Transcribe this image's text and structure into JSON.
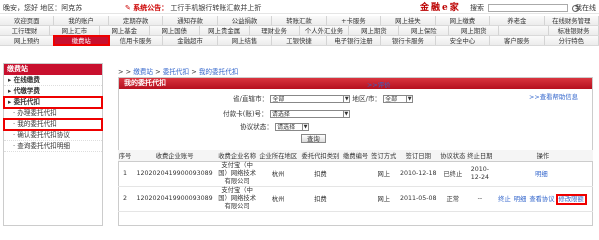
{
  "top": {
    "user_info": "晚安，您好 地区：阿克苏",
    "notice_label": "系统公告：",
    "notice_text": "工行手机银行转账汇款并上折",
    "logo": "金融e家",
    "search_label": "搜索",
    "logout": "我在线"
  },
  "nav": {
    "row1": [
      "欢迎页面",
      "我的账户",
      "定期存款",
      "通知存款",
      "公益捐款",
      "转账汇款",
      "+卡服务",
      "网上挂失",
      "网上缴费",
      "养老金",
      "在线财务管理"
    ],
    "row2": [
      "工行理财",
      "网上汇市",
      "网上基金",
      "网上国债",
      "网上贵金属",
      "理财业务",
      "个人外汇业务",
      "网上期货",
      "网上保险",
      "网上期货",
      "",
      "标准银财务"
    ],
    "row3": [
      "网上预约",
      "缴费站",
      "信用卡服务",
      "金融超市",
      "网上结售",
      "工银快捷",
      "电子银行注册",
      "银行卡服务",
      "安全中心",
      "客户服务",
      "分行特色"
    ]
  },
  "sidebar": {
    "head": "缴费站",
    "items": [
      {
        "label": "在线缴费",
        "group": true,
        "hl": false
      },
      {
        "label": "代缴学费",
        "group": true,
        "hl": false
      },
      {
        "label": "委托代扣",
        "group": true,
        "hl": true
      },
      {
        "label": "办理委托代扣",
        "group": false,
        "hl": false
      },
      {
        "label": "我的委托代扣",
        "group": false,
        "hl": true
      },
      {
        "label": "确认委托代扣协议",
        "group": false,
        "hl": false
      },
      {
        "label": "查询委托代扣明细",
        "group": false,
        "hl": false
      }
    ]
  },
  "breadcrumb": {
    "sep1": "> > ",
    "part1": "缴费站",
    "sep2": " > ",
    "part2": "委托代扣",
    "sep3": " > ",
    "part3": "我的委托代扣"
  },
  "panel": {
    "title": "我的委托代扣",
    "link_rate": "评价",
    "link_help": "查看帮助信息",
    "province_label": "省/直辖市：",
    "province_value": "全部",
    "region_label": "地区/市：",
    "region_value": "全部",
    "card_label": "付款卡(账)号：",
    "card_value": "请选择",
    "status_label": "协议状态：",
    "status_value": "请选择",
    "query_btn": "查询"
  },
  "table": {
    "headers": [
      "序号",
      "收费企业账号",
      "收费企业名称",
      "企业所在地区",
      "委托代扣类别",
      "缴费编号",
      "签订方式",
      "签订日期",
      "协议状态",
      "终止日期",
      "操作"
    ],
    "rows": [
      {
        "no": "1",
        "account": "1202020419900093089",
        "name": "支付宝（中国）网络技术有限公司",
        "area": "杭州",
        "type": "扣费",
        "code": "",
        "method": "网上",
        "date": "2010-12-18",
        "status": "已终止",
        "end": "2010-12-24",
        "ops": [
          "明细"
        ]
      },
      {
        "no": "2",
        "account": "1202020419900093089",
        "name": "支付宝（中国）网络技术有限公司",
        "area": "杭州",
        "type": "扣费",
        "code": "",
        "method": "网上",
        "date": "2011-05-08",
        "status": "正常",
        "end": "--",
        "ops": [
          "终止",
          "明细",
          "查看协议",
          "修改限额"
        ]
      }
    ]
  },
  "colors": {
    "brand": "#c8102e",
    "link": "#3366cc",
    "highlight": "#ee0000"
  }
}
